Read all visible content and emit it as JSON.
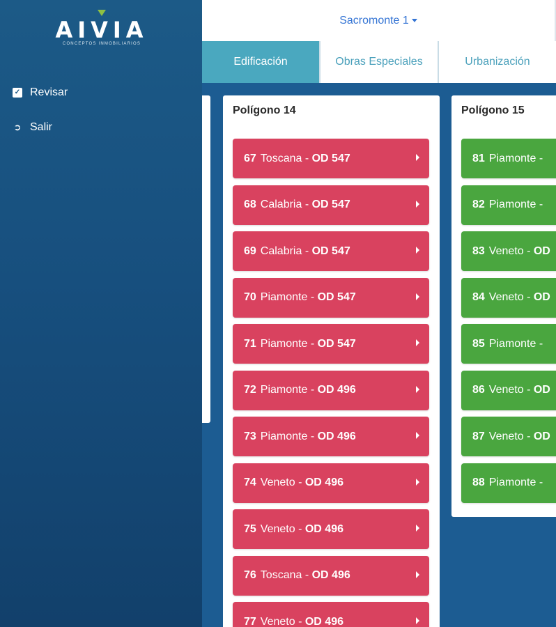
{
  "brand": {
    "name": "AIVIA",
    "tagline": "CONCEPTOS INMOBILIARIOS",
    "accent_color": "#8fc043"
  },
  "sidebar": {
    "items": [
      {
        "label": "Revisar",
        "icon": "checkbox-icon"
      },
      {
        "label": "Salir",
        "icon": "exit-icon"
      }
    ]
  },
  "header": {
    "selector_label": "Sacromonte 1"
  },
  "tabs": [
    {
      "label": "Edificación",
      "active": true
    },
    {
      "label": "Obras Especiales",
      "active": false
    },
    {
      "label": "Urbanización",
      "active": false
    }
  ],
  "colors": {
    "red_item": "#d9425f",
    "green_item": "#4aa63f",
    "active_tab": "#4aa8bf"
  },
  "panels": [
    {
      "title": "Polígono 14",
      "status_color": "red",
      "items": [
        {
          "num": "67",
          "name": "Toscana",
          "sep": " - ",
          "od": "OD 547"
        },
        {
          "num": "68",
          "name": "Calabria",
          "sep": " - ",
          "od": "OD 547"
        },
        {
          "num": "69",
          "name": "Calabria",
          "sep": " - ",
          "od": "OD 547"
        },
        {
          "num": "70",
          "name": "Piamonte",
          "sep": " - ",
          "od": "OD 547"
        },
        {
          "num": "71",
          "name": "Piamonte",
          "sep": " - ",
          "od": "OD 547"
        },
        {
          "num": "72",
          "name": "Piamonte",
          "sep": " - ",
          "od": "OD 496"
        },
        {
          "num": "73",
          "name": "Piamonte",
          "sep": " - ",
          "od": "OD 496"
        },
        {
          "num": "74",
          "name": "Veneto",
          "sep": " - ",
          "od": "OD 496"
        },
        {
          "num": "75",
          "name": "Veneto",
          "sep": " - ",
          "od": "OD 496"
        },
        {
          "num": "76",
          "name": "Toscana",
          "sep": " - ",
          "od": "OD 496"
        },
        {
          "num": "77",
          "name": "Veneto",
          "sep": " - ",
          "od": "OD 496"
        }
      ]
    },
    {
      "title": "Polígono 15",
      "status_color": "green",
      "items": [
        {
          "num": "81",
          "name": "Piamonte",
          "sep": " - ",
          "od": ""
        },
        {
          "num": "82",
          "name": "Piamonte",
          "sep": " - ",
          "od": ""
        },
        {
          "num": "83",
          "name": "Veneto",
          "sep": " - ",
          "od": "OD"
        },
        {
          "num": "84",
          "name": "Veneto",
          "sep": " - ",
          "od": "OD"
        },
        {
          "num": "85",
          "name": "Piamonte",
          "sep": " - ",
          "od": ""
        },
        {
          "num": "86",
          "name": "Veneto",
          "sep": " - ",
          "od": "OD"
        },
        {
          "num": "87",
          "name": "Veneto",
          "sep": " - ",
          "od": "OD"
        },
        {
          "num": "88",
          "name": "Piamonte",
          "sep": " - ",
          "od": ""
        }
      ]
    }
  ]
}
